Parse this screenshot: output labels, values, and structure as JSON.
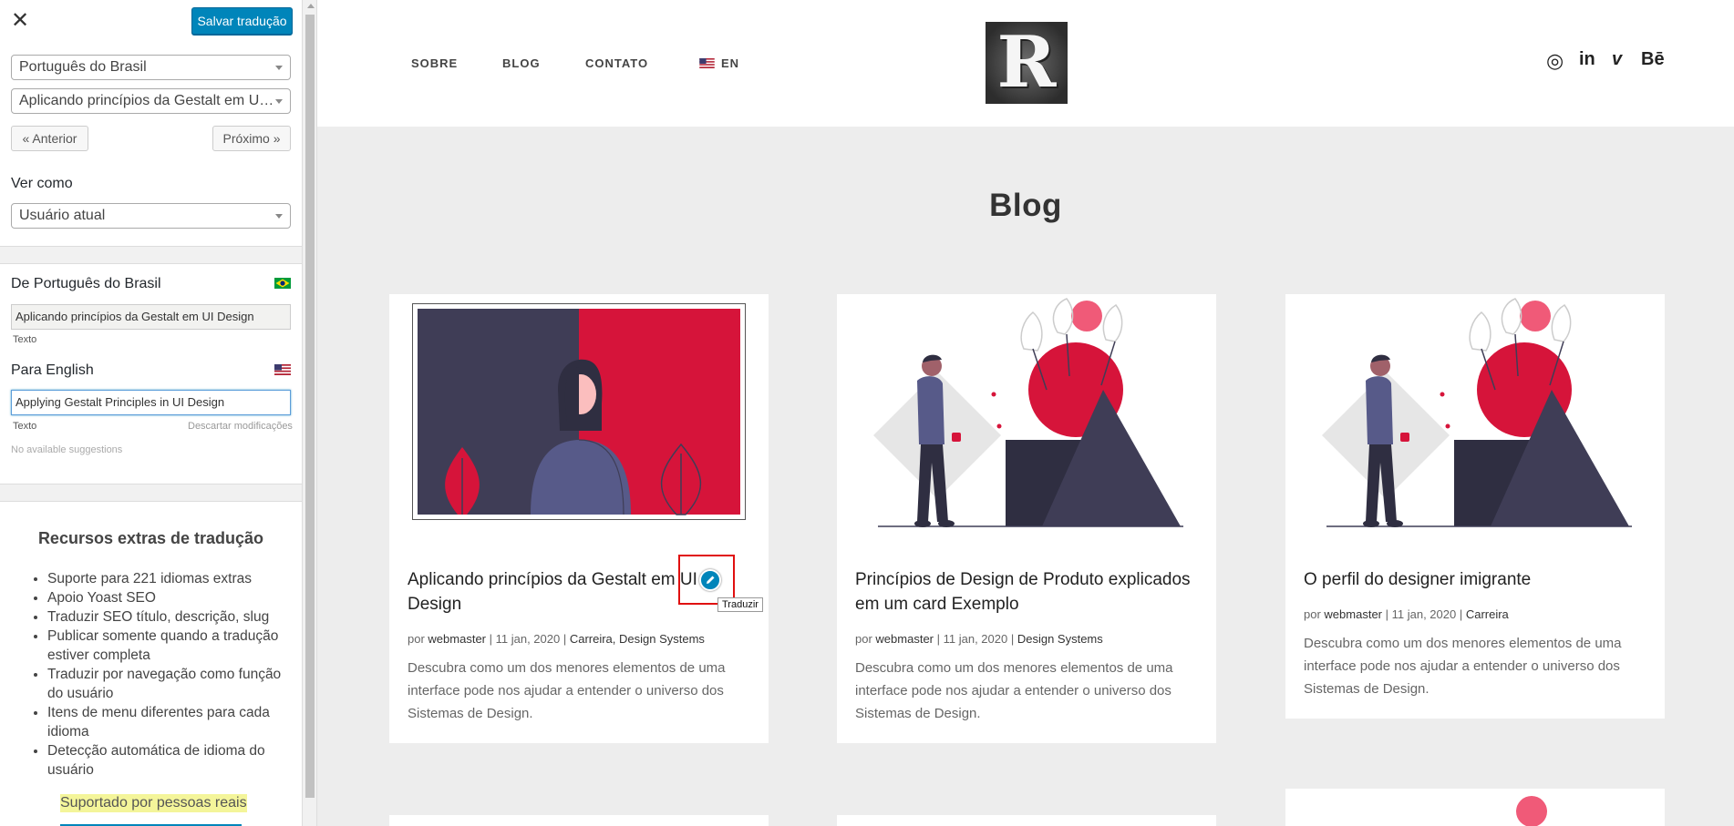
{
  "panel": {
    "close_glyph": "✕",
    "save_label": "Salvar tradução",
    "language_select": "Português do Brasil",
    "page_select": "Aplicando princípios da Gestalt em UI Design",
    "prev_label": "« Anterior",
    "next_label": "Próximo »",
    "view_as_label": "Ver como",
    "view_as_select": "Usuário atual",
    "from_label": "De Português do Brasil",
    "from_text": "Aplicando princípios da Gestalt em UI Design",
    "from_type": "Texto",
    "to_label": "Para English",
    "to_text": "Applying Gestalt Principles in UI Design",
    "to_type": "Texto",
    "discard_label": "Descartar modificações",
    "suggestions": "No available suggestions",
    "extras_title": "Recursos extras de tradução",
    "extras": [
      "Suporte para 221 idiomas extras",
      "Apoio Yoast SEO",
      "Traduzir SEO título, descrição, slug",
      "Publicar somente quando a tradução estiver completa",
      "Traduzir por navegação como função do usuário",
      "Itens de menu diferentes para cada idioma",
      "Detecção automática de idioma do usuário"
    ],
    "real_people": "Suportado por pessoas reais"
  },
  "site": {
    "nav": [
      "SOBRE",
      "BLOG",
      "CONTATO"
    ],
    "lang_switch": "EN",
    "logo_letter": "R",
    "social": [
      "instagram-icon",
      "linkedin-icon",
      "vimeo-icon",
      "behance-icon"
    ],
    "social_glyphs": [
      "◎",
      "in",
      "v",
      "Bē"
    ],
    "page_title": "Blog",
    "tooltip": "Traduzir",
    "cards": [
      {
        "title": "Aplicando princípios da Gestalt em UI Design",
        "by": "por",
        "author": "webmaster",
        "date": "11 jan, 2020",
        "categories": "Carreira, Design Systems",
        "excerpt": "Descubra como um dos menores elementos de uma interface pode nos ajudar a entender o universo dos Sistemas de Design."
      },
      {
        "title": "Princípios de Design de Produto explicados em um card Exemplo",
        "by": "por",
        "author": "webmaster",
        "date": "11 jan, 2020",
        "categories": "Design Systems",
        "excerpt": "Descubra como um dos menores elementos de uma interface pode nos ajudar a entender o universo dos Sistemas de Design."
      },
      {
        "title": "O perfil do designer imigrante",
        "by": "por",
        "author": "webmaster",
        "date": "11 jan, 2020",
        "categories": "Carreira",
        "excerpt": "Descubra como um dos menores elementos de uma interface pode nos ajudar a entender o universo dos Sistemas de Design."
      }
    ],
    "colors": {
      "accent": "#0085ba",
      "illustration_red": "#d6143a",
      "illustration_dark": "#3f3d56"
    }
  }
}
